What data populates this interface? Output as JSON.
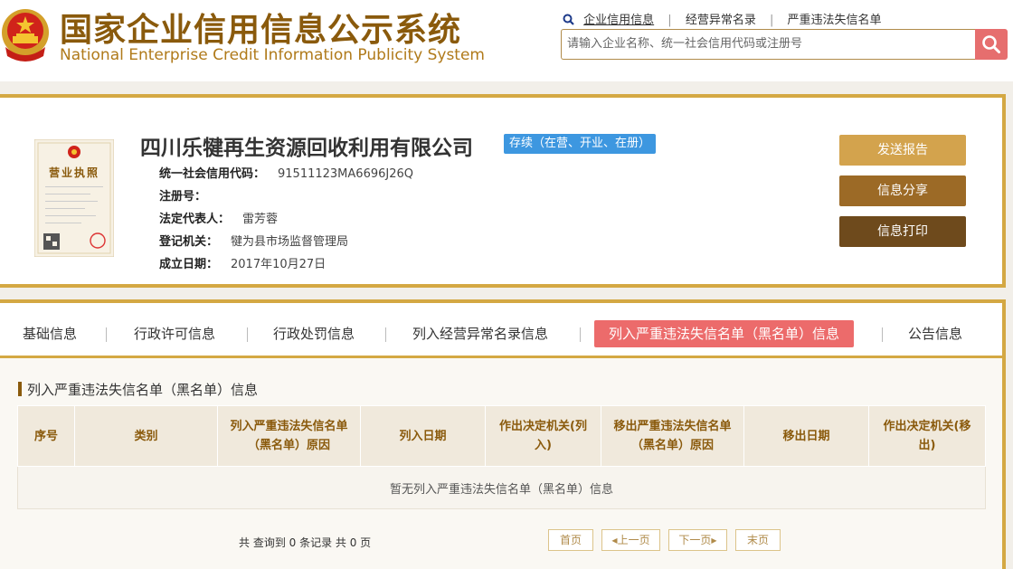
{
  "header": {
    "title": "国家企业信用信息公示系统",
    "subtitle": "National Enterprise Credit Information Publicity System",
    "nav": [
      "企业信用信息",
      "经营异常名录",
      "严重违法失信名单"
    ],
    "search_placeholder": "请输入企业名称、统一社会信用代码或注册号"
  },
  "company": {
    "license_title": "营业执照",
    "name": "四川乐犍再生资源回收利用有限公司",
    "status": "存续（在营、开业、在册）",
    "fields": [
      {
        "label": "统一社会信用代码：",
        "value": "91511123MA6696J26Q"
      },
      {
        "label": "注册号：",
        "value": ""
      },
      {
        "label": "法定代表人：",
        "value": "雷芳蓉"
      },
      {
        "label": "登记机关：",
        "value": "犍为县市场监督管理局"
      },
      {
        "label": "成立日期：",
        "value": "2017年10月27日"
      }
    ]
  },
  "actions": [
    "发送报告",
    "信息分享",
    "信息打印"
  ],
  "tabs": [
    "基础信息",
    "行政许可信息",
    "行政处罚信息",
    "列入经营异常名录信息",
    "列入严重违法失信名单（黑名单）信息",
    "公告信息"
  ],
  "section": {
    "title": "列入严重违法失信名单（黑名单）信息",
    "columns": [
      "序号",
      "类别",
      "列入严重违法失信名单（黑名单）原因",
      "列入日期",
      "作出决定机关(列入)",
      "移出严重违法失信名单（黑名单）原因",
      "移出日期",
      "作出决定机关(移出)"
    ],
    "empty_text": "暂无列入严重违法失信名单（黑名单）信息"
  },
  "pager": {
    "info": "共 查询到 0 条记录 共 0 页",
    "first": "首页",
    "prev": "上一页",
    "next": "下一页",
    "last": "末页"
  },
  "colors": {
    "gold": "#d4a843",
    "brown": "#8a5a0c",
    "red": "#ec6b6b",
    "blue": "#3d97e0"
  }
}
